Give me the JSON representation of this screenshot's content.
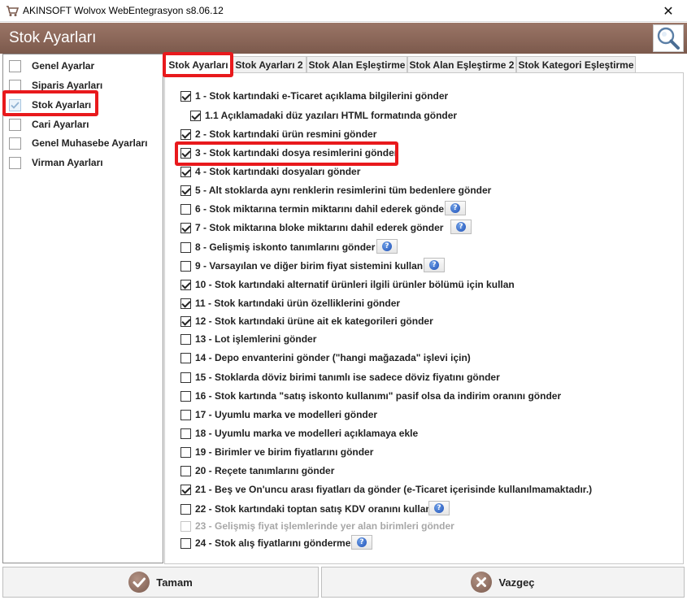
{
  "window": {
    "title": "AKINSOFT Wolvox WebEntegrasyon s8.06.12",
    "close_glyph": "✕"
  },
  "header": {
    "title": "Stok Ayarları",
    "search_icon": "search-icon"
  },
  "sidebar": {
    "items": [
      {
        "label": "Genel Ayarlar"
      },
      {
        "label": "Siparis Ayarları"
      },
      {
        "label": "Stok Ayarları",
        "selected": true
      },
      {
        "label": "Cari Ayarları"
      },
      {
        "label": "Genel Muhasebe Ayarları"
      },
      {
        "label": "Virman Ayarları"
      }
    ]
  },
  "tabs": [
    {
      "label": "Stok Ayarları",
      "active": true
    },
    {
      "label": "Stok Ayarları 2"
    },
    {
      "label": "Stok Alan Eşleştirme"
    },
    {
      "label": "Stok Alan Eşleştirme 2"
    },
    {
      "label": "Stok Kategori Eşleştirme"
    }
  ],
  "options": [
    {
      "label": "1 - Stok kartındaki e-Ticaret açıklama bilgilerini gönder",
      "checked": true,
      "help": false,
      "indent": false,
      "disabled": false
    },
    {
      "label": "1.1 Açıklamadaki düz yazıları HTML formatında gönder",
      "checked": true,
      "help": false,
      "indent": true,
      "disabled": false
    },
    {
      "label": "2 - Stok kartındaki ürün resmini gönder",
      "checked": true,
      "help": false,
      "indent": false,
      "disabled": false
    },
    {
      "label": "3 - Stok kartındaki dosya resimlerini gönder",
      "checked": true,
      "help": false,
      "indent": false,
      "disabled": false
    },
    {
      "label": "4 - Stok kartındaki dosyaları gönder",
      "checked": true,
      "help": false,
      "indent": false,
      "disabled": false
    },
    {
      "label": "5 - Alt stoklarda aynı renklerin resimlerini tüm bedenlere gönder",
      "checked": true,
      "help": false,
      "indent": false,
      "disabled": false
    },
    {
      "label": "6 - Stok miktarına termin miktarını dahil ederek gönder",
      "checked": false,
      "help": true,
      "indent": false,
      "disabled": false
    },
    {
      "label": "7 - Stok miktarına bloke miktarını dahil ederek gönder",
      "checked": true,
      "help": true,
      "indent": false,
      "disabled": false
    },
    {
      "label": "8 - Gelişmiş iskonto tanımlarını gönder",
      "checked": false,
      "help": true,
      "indent": false,
      "disabled": false
    },
    {
      "label": "9 - Varsayılan ve diğer birim fiyat sistemini kullan",
      "checked": false,
      "help": true,
      "indent": false,
      "disabled": false
    },
    {
      "label": "10 - Stok kartındaki alternatif ürünleri ilgili ürünler bölümü için kullan",
      "checked": true,
      "help": false,
      "indent": false,
      "disabled": false
    },
    {
      "label": "11 - Stok kartındaki ürün özelliklerini gönder",
      "checked": true,
      "help": false,
      "indent": false,
      "disabled": false
    },
    {
      "label": "12 - Stok kartındaki ürüne ait ek kategorileri gönder",
      "checked": true,
      "help": false,
      "indent": false,
      "disabled": false
    },
    {
      "label": "13 - Lot işlemlerini gönder",
      "checked": false,
      "help": false,
      "indent": false,
      "disabled": false
    },
    {
      "label": "14 - Depo envanterini gönder (\"hangi mağazada\" işlevi için)",
      "checked": false,
      "help": false,
      "indent": false,
      "disabled": false
    },
    {
      "label": "15 - Stoklarda döviz birimi tanımlı ise sadece döviz fiyatını gönder",
      "checked": false,
      "help": false,
      "indent": false,
      "disabled": false
    },
    {
      "label": "16 - Stok kartında \"satış iskonto kullanımı\" pasif olsa da indirim oranını gönder",
      "checked": false,
      "help": false,
      "indent": false,
      "disabled": false
    },
    {
      "label": "17 - Uyumlu marka ve modelleri gönder",
      "checked": false,
      "help": false,
      "indent": false,
      "disabled": false
    },
    {
      "label": "18 - Uyumlu marka ve modelleri açıklamaya ekle",
      "checked": false,
      "help": false,
      "indent": false,
      "disabled": false
    },
    {
      "label": "19 - Birimler ve birim fiyatlarını gönder",
      "checked": false,
      "help": false,
      "indent": false,
      "disabled": false
    },
    {
      "label": "20 - Reçete tanımlarını gönder",
      "checked": false,
      "help": false,
      "indent": false,
      "disabled": false
    },
    {
      "label": "21 - Beş ve On'uncu arası fiyatları da gönder (e-Ticaret içerisinde kullanılmamaktadır.)",
      "checked": true,
      "help": false,
      "indent": false,
      "disabled": false
    },
    {
      "label": "22 - Stok kartındaki toptan satış KDV oranını kullan",
      "checked": false,
      "help": true,
      "indent": false,
      "disabled": false
    },
    {
      "label": "23 - Gelişmiş fiyat işlemlerinde yer alan birimleri gönder",
      "checked": false,
      "help": false,
      "indent": false,
      "disabled": true
    },
    {
      "label": "24 - Stok alış fiyatlarını gönderme",
      "checked": false,
      "help": true,
      "indent": false,
      "disabled": false
    }
  ],
  "help_glyph": "?",
  "buttons": {
    "ok_label": "Tamam",
    "cancel_label": "Vazgeç"
  },
  "colors": {
    "header": "#8a6658",
    "highlight": "#e8191c"
  }
}
